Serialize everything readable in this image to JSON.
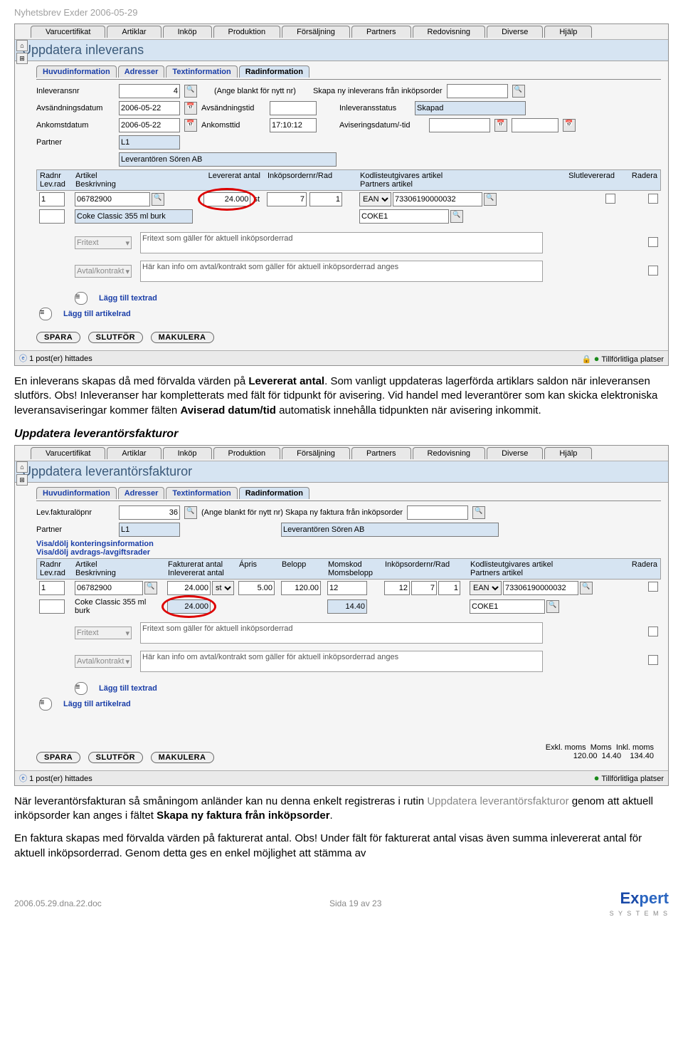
{
  "doc": {
    "header": "Nyhetsbrev Exder 2006-05-29",
    "footer_file": "2006.05.29.dna.22.doc",
    "footer_page": "Sida 19 av 23"
  },
  "menu": [
    "Varucertifikat",
    "Artiklar",
    "Inköp",
    "Produktion",
    "Försäljning",
    "Partners",
    "Redovisning",
    "Diverse",
    "Hjälp"
  ],
  "form_tabs": [
    "Huvudinformation",
    "Adresser",
    "Textinformation",
    "Radinformation"
  ],
  "screen1": {
    "title": "Uppdatera inleverans",
    "labels": {
      "inlev_nr": "Inleveransnr",
      "note_blank": "(Ange blankt för nytt nr)",
      "skapa_ny": "Skapa ny inleverans från inköpsorder",
      "avs_datum": "Avsändningsdatum",
      "avs_tid": "Avsändningstid",
      "inlev_status": "Inleveransstatus",
      "ankomst_datum": "Ankomstdatum",
      "ankomst_tid": "Ankomsttid",
      "avis": "Aviseringsdatum/-tid",
      "partner": "Partner",
      "lagg_textrad": "Lägg till textrad",
      "lagg_artikelrad": "Lägg till artikelrad",
      "posts": "1 post(er) hittades",
      "trusted": "Tillförlitliga platser",
      "slutlev": "Slutlevererad",
      "radera": "Radera"
    },
    "values": {
      "inlev_nr": "4",
      "avs_datum": "2006-05-22",
      "ankomst_datum": "2006-05-22",
      "ankomst_tid": "17:10:12",
      "status": "Skapad",
      "partner_code": "L1",
      "partner_name": "Leverantören Sören AB",
      "artikel": "06782900",
      "artikel_desc": "Coke Classic 355 ml burk",
      "lev_antal": "24.000",
      "unit": "st",
      "order_nr": "7",
      "rad": "1",
      "ean_sel": "EAN",
      "ean": "73306190000032",
      "coke": "COKE1",
      "fritext_sel": "Fritext",
      "fritext": "Fritext som gäller för aktuell inköpsorderrad",
      "avtal_sel": "Avtal/kontrakt",
      "avtal": "Här kan info om avtal/kontrakt som gäller för aktuell inköpsorderrad anges"
    },
    "grid_head": {
      "radnr": "Radnr\nLev.rad",
      "artikel": "Artikel\nBeskrivning",
      "lev": "Levererat antal",
      "order": "Inköpsordernr/Rad",
      "kod": "Kodlisteutgivares artikel\nPartners artikel"
    }
  },
  "body1": {
    "p1a": "En inleverans skapas då med förvalda värden på ",
    "p1b": "Levererat antal",
    "p1c": ". Som vanligt uppdateras lagerförda artiklars saldon när inleveransen slutförs. Obs! Inleveranser har kompletterats med fält för tidpunkt för avisering. Vid handel med leverantörer som kan skicka elektroniska leveransaviseringar kommer fälten ",
    "p1d": "Aviserad datum/tid",
    "p1e": " automatisk innehålla tidpunkten när avisering inkommit."
  },
  "section2_head": "Uppdatera leverantörsfakturor",
  "screen2": {
    "title": "Uppdatera leverantörsfakturor",
    "labels": {
      "lopnr": "Lev.fakturalöpnr",
      "note_blank": "(Ange blankt för nytt nr) Skapa ny faktura från inköpsorder",
      "partner": "Partner",
      "kontering": "Visa/dölj konteringsinformation",
      "avdrag": "Visa/dölj avdrags-/avgiftsrader",
      "lagg_textrad": "Lägg till textrad",
      "lagg_artikelrad": "Lägg till artikelrad",
      "posts": "1 post(er) hittades",
      "trusted": "Tillförlitliga platser",
      "radera": "Radera"
    },
    "values": {
      "lopnr": "36",
      "partner_code": "L1",
      "partner_name": "Leverantören Sören AB",
      "artikel": "06782900",
      "artikel_desc": "Coke Classic 355 ml burk",
      "fakt_antal": "24.000",
      "inlev_antal": "24.000",
      "unit": "st",
      "apris": "5.00",
      "belopp": "120.00",
      "momskod": "12",
      "momsbelopp": "14.40",
      "order_nr": "12",
      "order_nr2": "7",
      "rad": "1",
      "ean_sel": "EAN",
      "ean": "73306190000032",
      "coke": "COKE1",
      "fritext": "Fritext som gäller för aktuell inköpsorderrad",
      "avtal": "Här kan info om avtal/kontrakt som gäller för aktuell inköpsorderrad anges"
    },
    "grid_head": {
      "radnr": "Radnr\nLev.rad",
      "artikel": "Artikel\nBeskrivning",
      "fakt": "Fakturerat antal\nInlevererat antal",
      "apris": "Ápris",
      "belopp": "Belopp",
      "moms": "Momskod\nMomsbelopp",
      "order": "Inköpsordernr/Rad",
      "kod": "Kodlisteutgivares artikel\nPartners artikel"
    },
    "totals": {
      "h1": "Exkl. moms",
      "h2": "Moms",
      "h3": "Inkl. moms",
      "v1": "120.00",
      "v2": "14.40",
      "v3": "134.40"
    }
  },
  "buttons": {
    "spara": "SPARA",
    "slutfor": "SLUTFÖR",
    "makulera": "MAKULERA"
  },
  "body2": {
    "p1a": "När leverantörsfakturan så småningom anländer kan nu denna enkelt registreras i rutin ",
    "p1b": "Uppdatera leverantörsfakturor",
    "p1c": " genom att aktuell inköpsorder kan anges i fältet ",
    "p1d": "Skapa ny faktura från inköpsorder",
    "p1e": ".",
    "p2": "En faktura skapas med förvalda värden på fakturerat antal. Obs! Under fält för fakturerat antal visas även summa inlevererat antal för aktuell inköpsorderrad. Genom detta ges en enkel möjlighet att stämma av"
  }
}
